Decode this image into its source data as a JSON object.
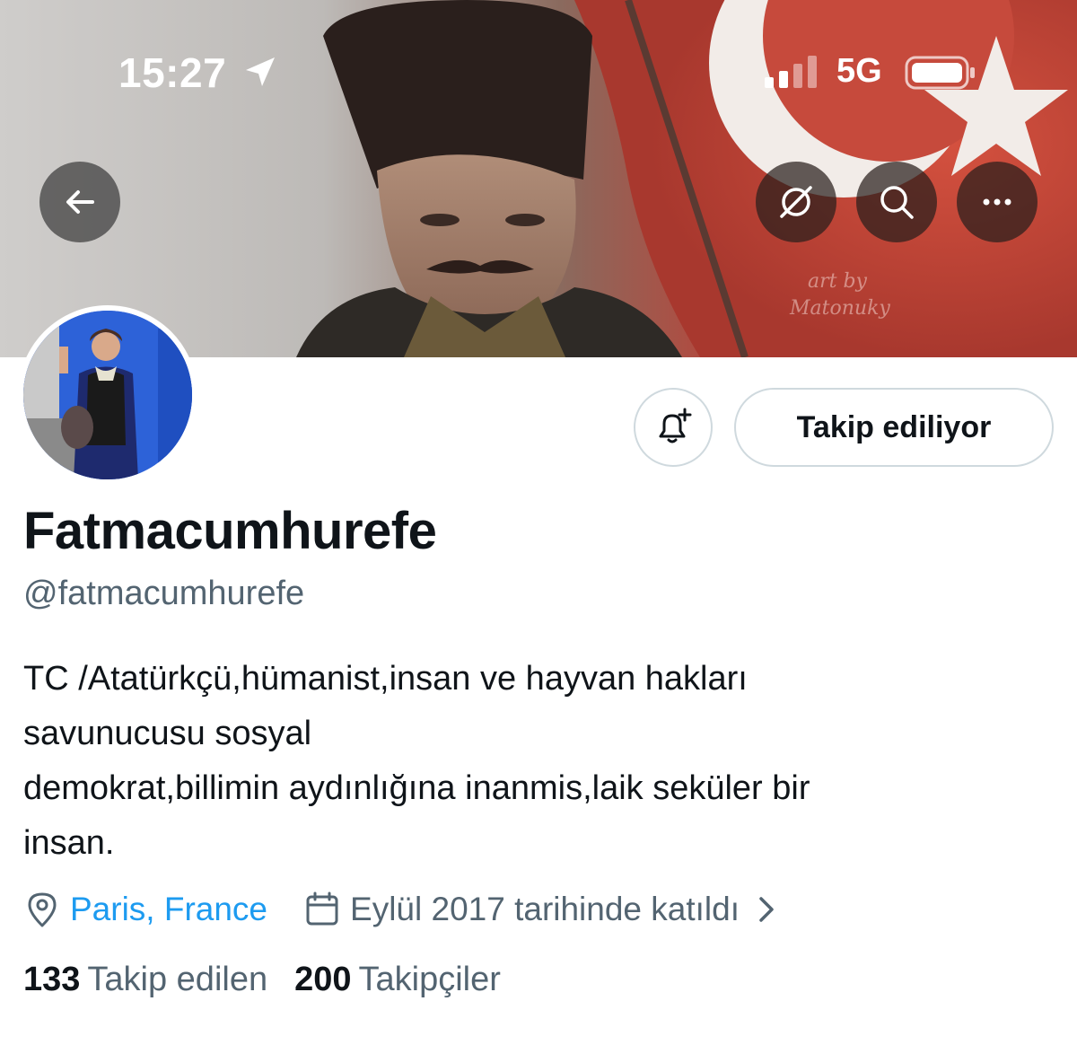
{
  "status_bar": {
    "time": "15:27",
    "network": "5G"
  },
  "header": {
    "icons": {
      "back": "arrow-left-icon",
      "grok": "grok-icon",
      "search": "search-icon",
      "more": "more-dots-icon"
    }
  },
  "actions": {
    "notify_icon": "bell-plus-icon",
    "follow_label": "Takip ediliyor"
  },
  "profile": {
    "display_name": "Fatmacumhurefe",
    "handle": "@fatmacumhurefe",
    "bio_lines": [
      "TC /Atatürkçü,hümanist,insan ve hayvan hakları",
      "savunucusu sosyal",
      "demokrat,billimin aydınlığına inanmis,laik seküler bir",
      "insan."
    ],
    "location": "Paris, France",
    "joined": "Eylül 2017 tarihinde katıldı"
  },
  "stats": {
    "following_count": "133",
    "following_label": "Takip edilen",
    "followers_count": "200",
    "followers_label": "Takipçiler"
  },
  "colors": {
    "link": "#1d9bf0",
    "secondary_text": "#536471",
    "primary_text": "#0f1419",
    "border": "#cfd9de"
  }
}
